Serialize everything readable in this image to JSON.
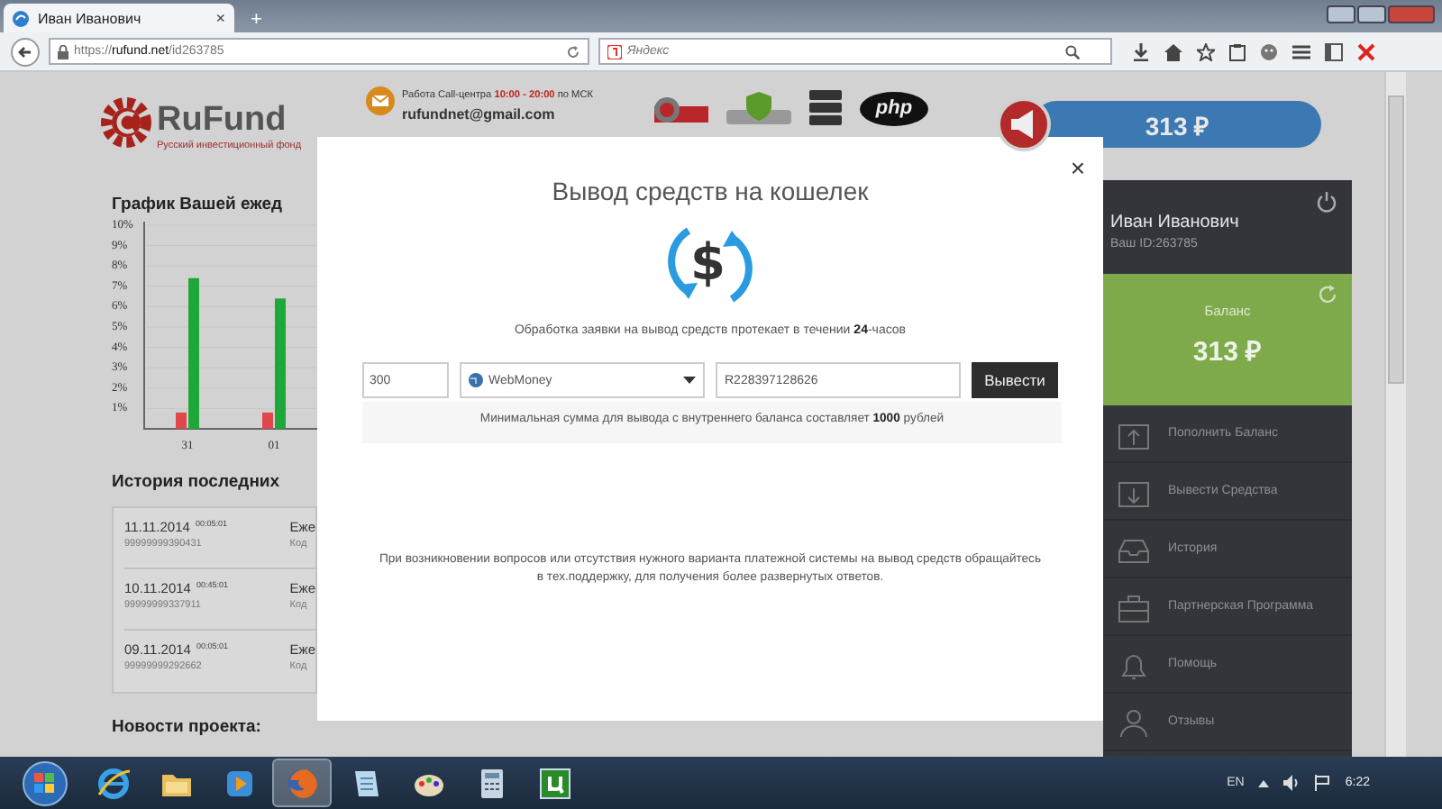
{
  "browser": {
    "tab": {
      "title": "Иван Иванович",
      "close": "×"
    },
    "new_tab": "+",
    "address": "https://**rufund.net**/id263785",
    "search": {
      "placeholder": "Яндекс"
    }
  },
  "header": {
    "logo": {
      "name": "RuFund",
      "tagline": "Русский инвестиционный фонд"
    },
    "call_center": "Работа Call-центра **10:00 - 20:00** по МСК",
    "email": "rufundnet@gmail.com",
    "badges": [
      {
        "kind": "seal"
      },
      {
        "kind": "shield"
      },
      {
        "kind": "server"
      },
      {
        "kind": "php",
        "label": "php"
      }
    ],
    "balance": "313 ₽"
  },
  "chart": {
    "title": "График Вашей ежед",
    "chart_data": {
      "type": "bar",
      "grid": true,
      "categories": [
        "31",
        "01"
      ],
      "series": [
        {
          "color": "#e0474c",
          "values": [
            0.8,
            0.8
          ]
        },
        {
          "color": "#1fa83a",
          "values": [
            7.4,
            6.4
          ]
        }
      ],
      "ylim": [
        0,
        10
      ],
      "yticks": [
        {
          "value": 1,
          "label": "1%"
        },
        {
          "value": 2,
          "label": "2%"
        },
        {
          "value": 3,
          "label": "3%"
        },
        {
          "value": 4,
          "label": "4%"
        },
        {
          "value": 5,
          "label": "5%"
        },
        {
          "value": 6,
          "label": "6%"
        },
        {
          "value": 7,
          "label": "7%"
        },
        {
          "value": 8,
          "label": "8%"
        },
        {
          "value": 9,
          "label": "9%"
        },
        {
          "value": 10,
          "label": "10%"
        }
      ]
    }
  },
  "history": {
    "title": "История последних",
    "rows": [
      {
        "date": "11.11.2014",
        "time": "00:05:01",
        "code": "99999999390431",
        "type": "Еже",
        "detail": "Код"
      },
      {
        "date": "10.11.2014",
        "time": "00:45:01",
        "code": "99999999337911",
        "type": "Еже",
        "detail": "Код"
      },
      {
        "date": "09.11.2014",
        "time": "00:05:01",
        "code": "99999999292662",
        "type": "Еже",
        "detail": "Код"
      }
    ]
  },
  "news": {
    "title": "Новости проекта:"
  },
  "modal": {
    "title": "Вывод средств на кошелек",
    "close": "×",
    "icon_symbol": "$",
    "notice": "Обработка заявки на вывод средств протекает в течении **24**-часов",
    "amount": "300",
    "method": "WebMoney",
    "wallet": "R228397128626",
    "submit": "Вывести",
    "minimum": "Минимальная сумма для вывода с внутреннего баланса составляет **1000** рублей",
    "help": "При возникновении вопросов или отсутствия нужного варианта платежной системы на вывод средств обращайтесь в тех.поддержку, для получения более развернутых ответов."
  },
  "sidebar": {
    "user": "Иван Иванович",
    "user_id": "Ваш ID:263785",
    "balance_label": "Баланс",
    "balance": "313 ₽",
    "menu": [
      {
        "kind": "deposit",
        "label": "Пополнить Баланс"
      },
      {
        "kind": "withdraw",
        "label": "Вывести Средства"
      },
      {
        "kind": "history",
        "label": "История"
      },
      {
        "kind": "partner",
        "label": "Партнерская Программа"
      },
      {
        "kind": "help",
        "label": "Помощь"
      },
      {
        "kind": "reviews",
        "label": "Отзывы"
      }
    ]
  },
  "taskbar": {
    "apps": [
      {
        "kind": "ie",
        "selected": false
      },
      {
        "kind": "explorer",
        "selected": false
      },
      {
        "kind": "media",
        "selected": false
      },
      {
        "kind": "firefox",
        "selected": true
      },
      {
        "kind": "notes",
        "selected": false
      },
      {
        "kind": "paint",
        "selected": false
      },
      {
        "kind": "calculator",
        "selected": false
      },
      {
        "kind": "torrent",
        "selected": false
      }
    ],
    "language": "EN",
    "clock": "6:22"
  }
}
